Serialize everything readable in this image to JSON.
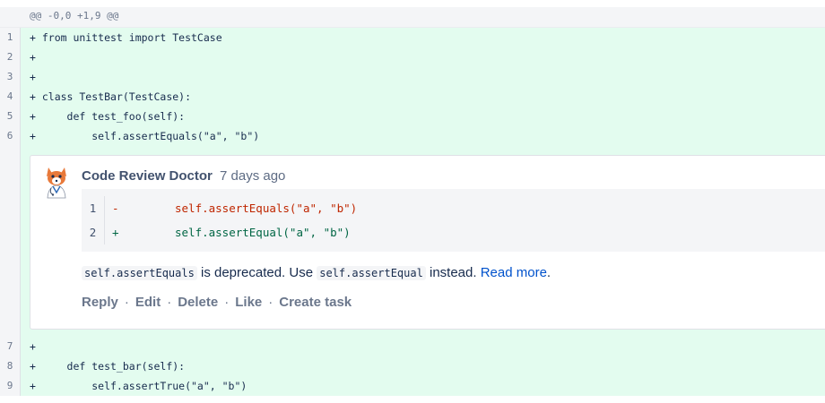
{
  "hunk_header": "@@ -0,0 +1,9 @@",
  "lines_top": [
    {
      "num": "1",
      "text": "+ from unittest import TestCase"
    },
    {
      "num": "2",
      "text": "+"
    },
    {
      "num": "3",
      "text": "+"
    },
    {
      "num": "4",
      "text": "+ class TestBar(TestCase):"
    },
    {
      "num": "5",
      "text": "+     def test_foo(self):"
    },
    {
      "num": "6",
      "text": "+         self.assertEquals(\"a\", \"b\")"
    }
  ],
  "comment": {
    "author": "Code Review Doctor",
    "time": "7 days ago",
    "avatar_icon": "fox-doctor-avatar-icon",
    "suggestion": [
      {
        "num": "1",
        "sign": "-",
        "code": "self.assertEquals(\"a\", \"b\")",
        "kind": "del"
      },
      {
        "num": "2",
        "sign": "+",
        "code": "self.assertEqual(\"a\", \"b\")",
        "kind": "add"
      }
    ],
    "body": {
      "code1": "self.assertEquals",
      "text1": " is deprecated. Use ",
      "code2": "self.assertEqual",
      "text2": " instead. ",
      "link": "Read more",
      "text3": "."
    },
    "actions": [
      "Reply",
      "Edit",
      "Delete",
      "Like",
      "Create task"
    ]
  },
  "lines_bottom": [
    {
      "num": "7",
      "text": "+"
    },
    {
      "num": "8",
      "text": "+     def test_bar(self):"
    },
    {
      "num": "9",
      "text": "+         self.assertTrue(\"a\", \"b\")"
    }
  ],
  "colors": {
    "added_bg": "#e3fcef",
    "gutter_bg": "#f4f5f7",
    "link": "#0052cc",
    "deleted_text": "#bf2600",
    "added_text": "#006644"
  }
}
